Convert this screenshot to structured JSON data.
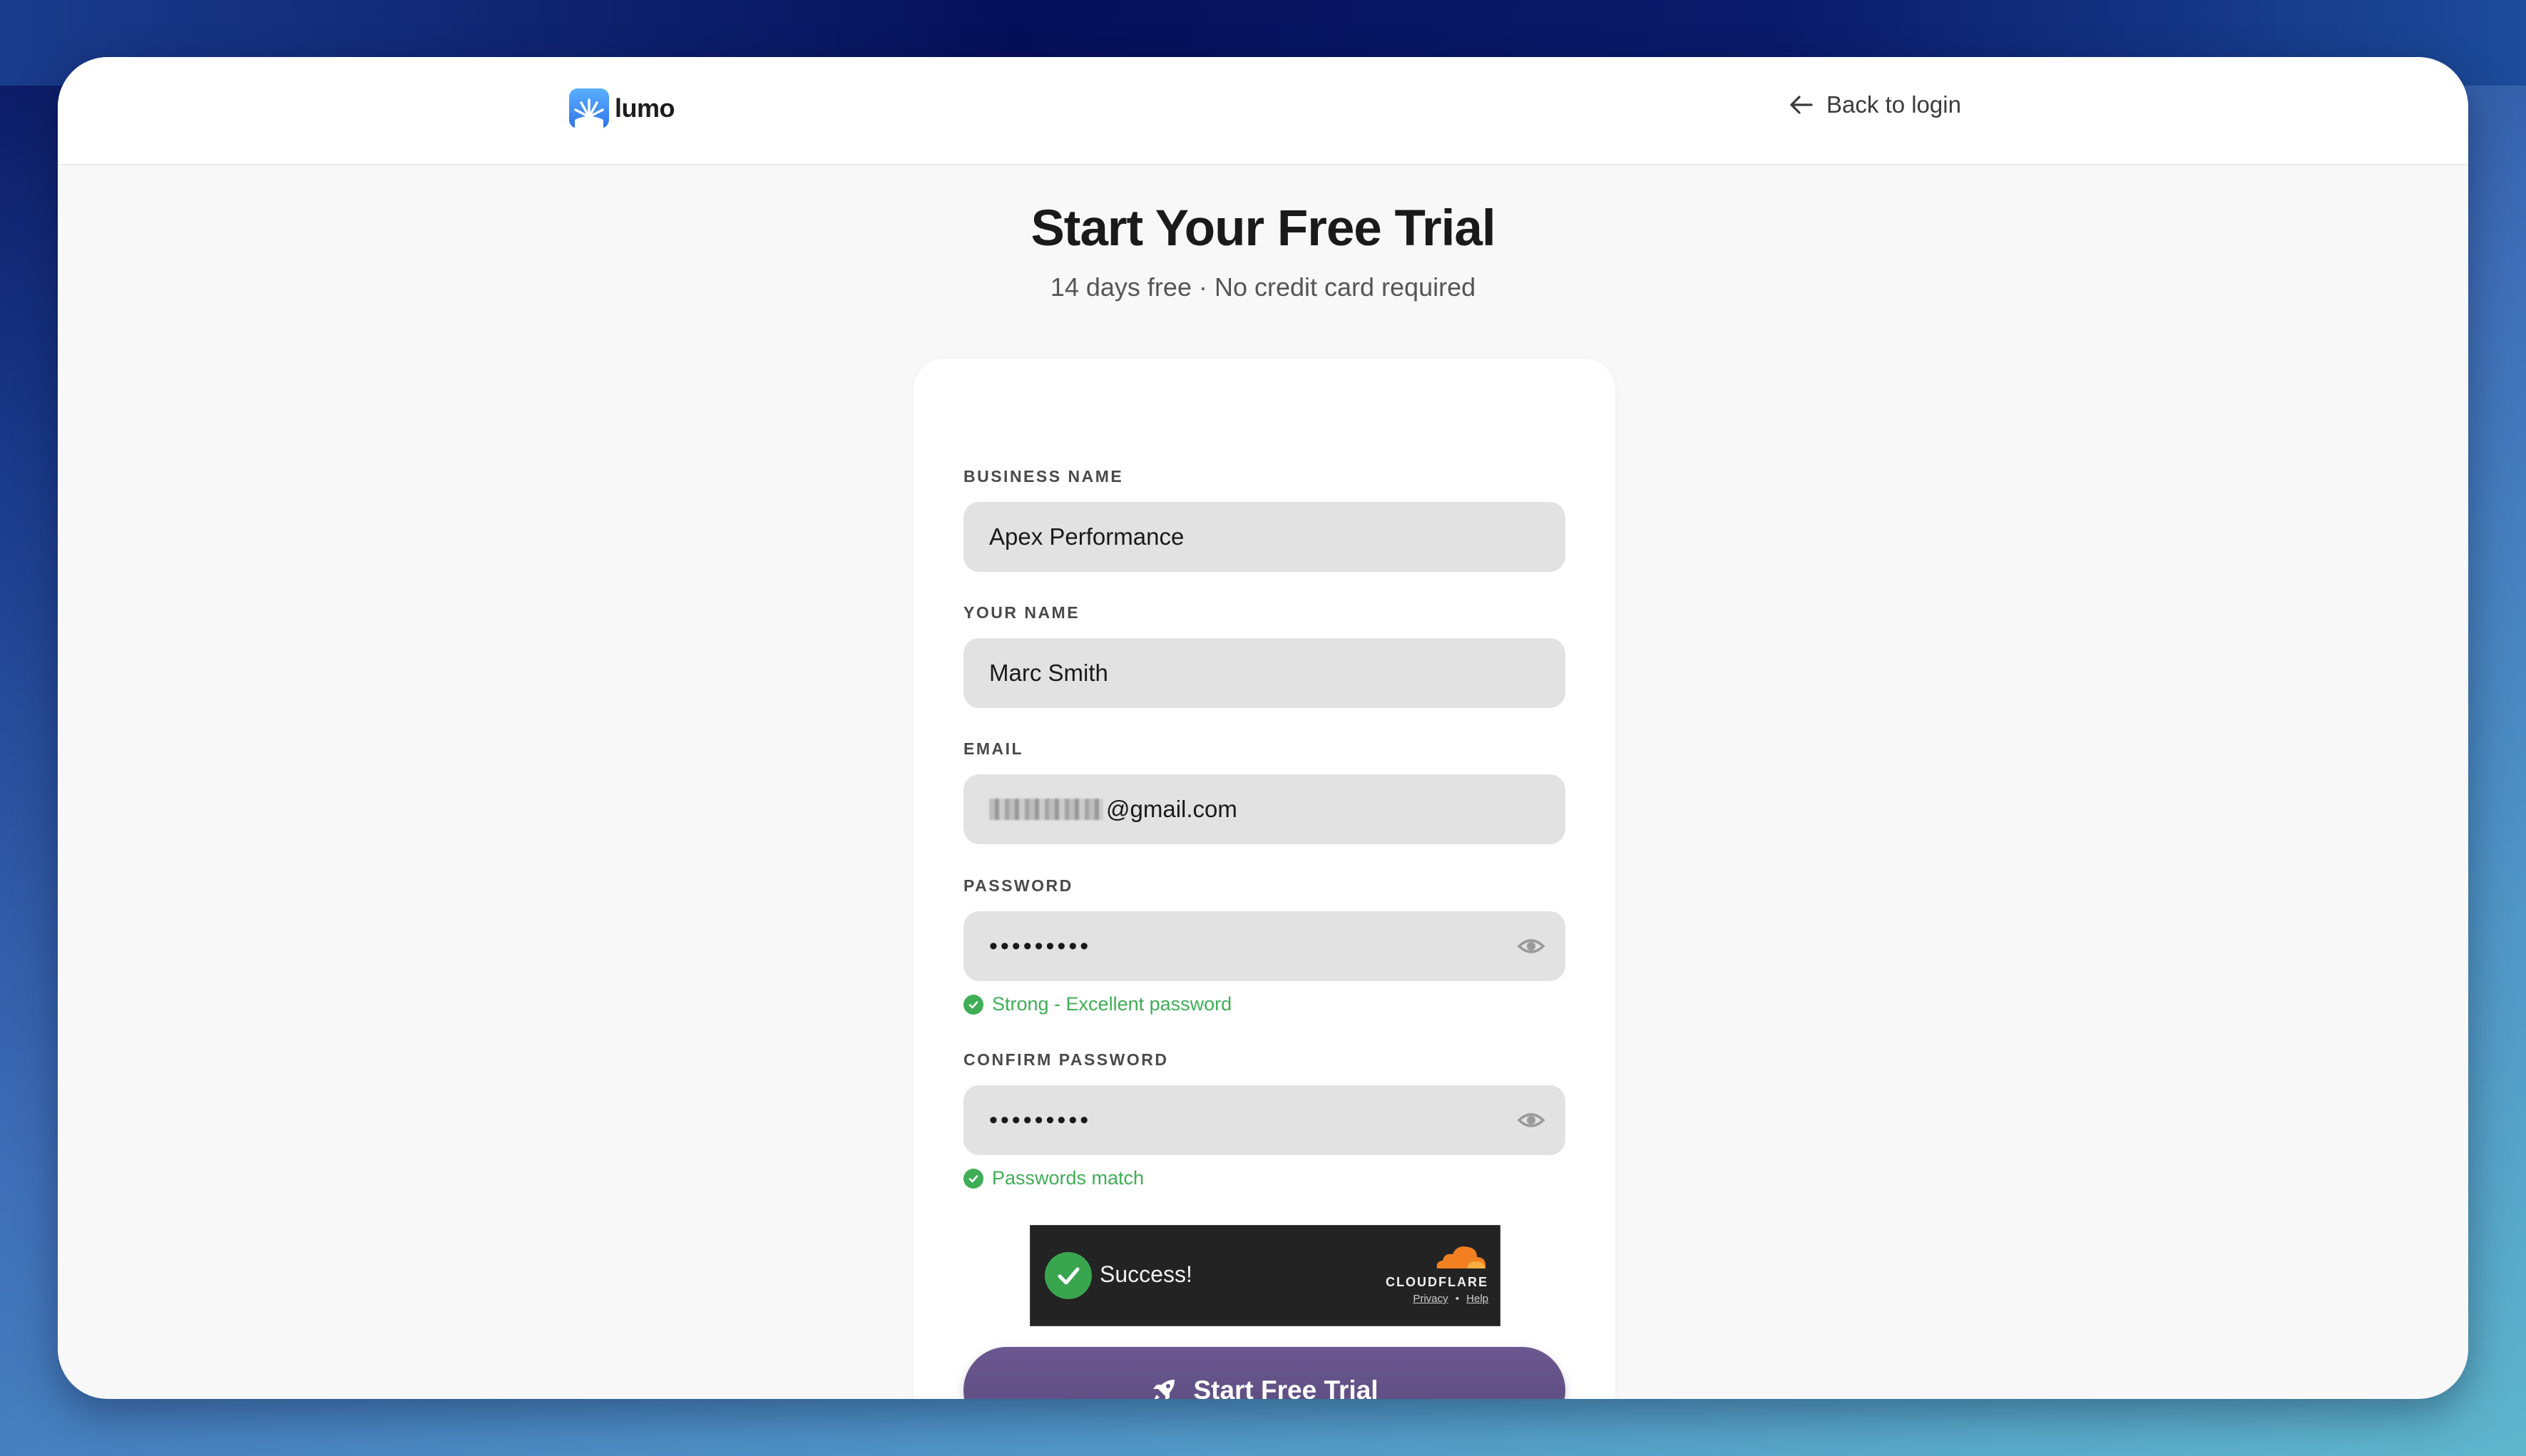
{
  "brand": {
    "name": "lumo"
  },
  "header": {
    "back_label": "Back to login"
  },
  "page": {
    "title": "Start Your Free Trial",
    "subtitle": "14 days free · No credit card required"
  },
  "form": {
    "business_name": {
      "label": "BUSINESS NAME",
      "value": "Apex Performance"
    },
    "your_name": {
      "label": "YOUR NAME",
      "value": "Marc Smith"
    },
    "email": {
      "label": "EMAIL",
      "value_visible": "@gmail.com"
    },
    "password": {
      "label": "PASSWORD",
      "value": "•••••••••",
      "hint": "Strong - Excellent password"
    },
    "confirm_password": {
      "label": "CONFIRM PASSWORD",
      "value": "•••••••••",
      "hint": "Passwords match"
    },
    "submit_label": "Start Free Trial"
  },
  "captcha": {
    "status": "Success!",
    "provider": "CLOUDFLARE",
    "privacy": "Privacy",
    "separator": "•",
    "help": "Help"
  },
  "colors": {
    "accent": "#5e4e82",
    "success": "#3fae56",
    "logo": "#2f74e8"
  },
  "icons": {
    "back": "arrow-left-icon",
    "eye": "eye-icon",
    "check": "check-circle-icon",
    "rocket": "rocket-icon",
    "cloud": "cloudflare-cloud-icon"
  }
}
